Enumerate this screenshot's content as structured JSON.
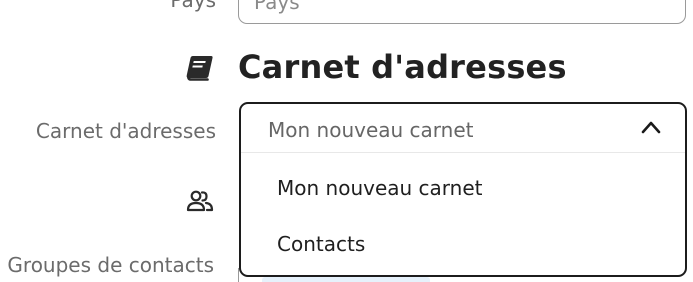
{
  "country": {
    "label": "Pays",
    "placeholder": "Pays"
  },
  "address_book_section": {
    "icon": "address-book-icon",
    "title": "Carnet d'adresses"
  },
  "address_book_field": {
    "label": "Carnet d'adresses",
    "selected": "Mon nouveau carnet",
    "expanded": true,
    "options": [
      {
        "label": "Mon nouveau carnet"
      },
      {
        "label": "Contacts"
      }
    ]
  },
  "contact_groups": {
    "icon": "contact-groups-icon",
    "label": "Groupes de contacts"
  },
  "colors": {
    "text": "#222222",
    "label": "#6b6b6b",
    "dropdown_border": "#1c1c1c",
    "input_border": "#9a9a9a"
  }
}
